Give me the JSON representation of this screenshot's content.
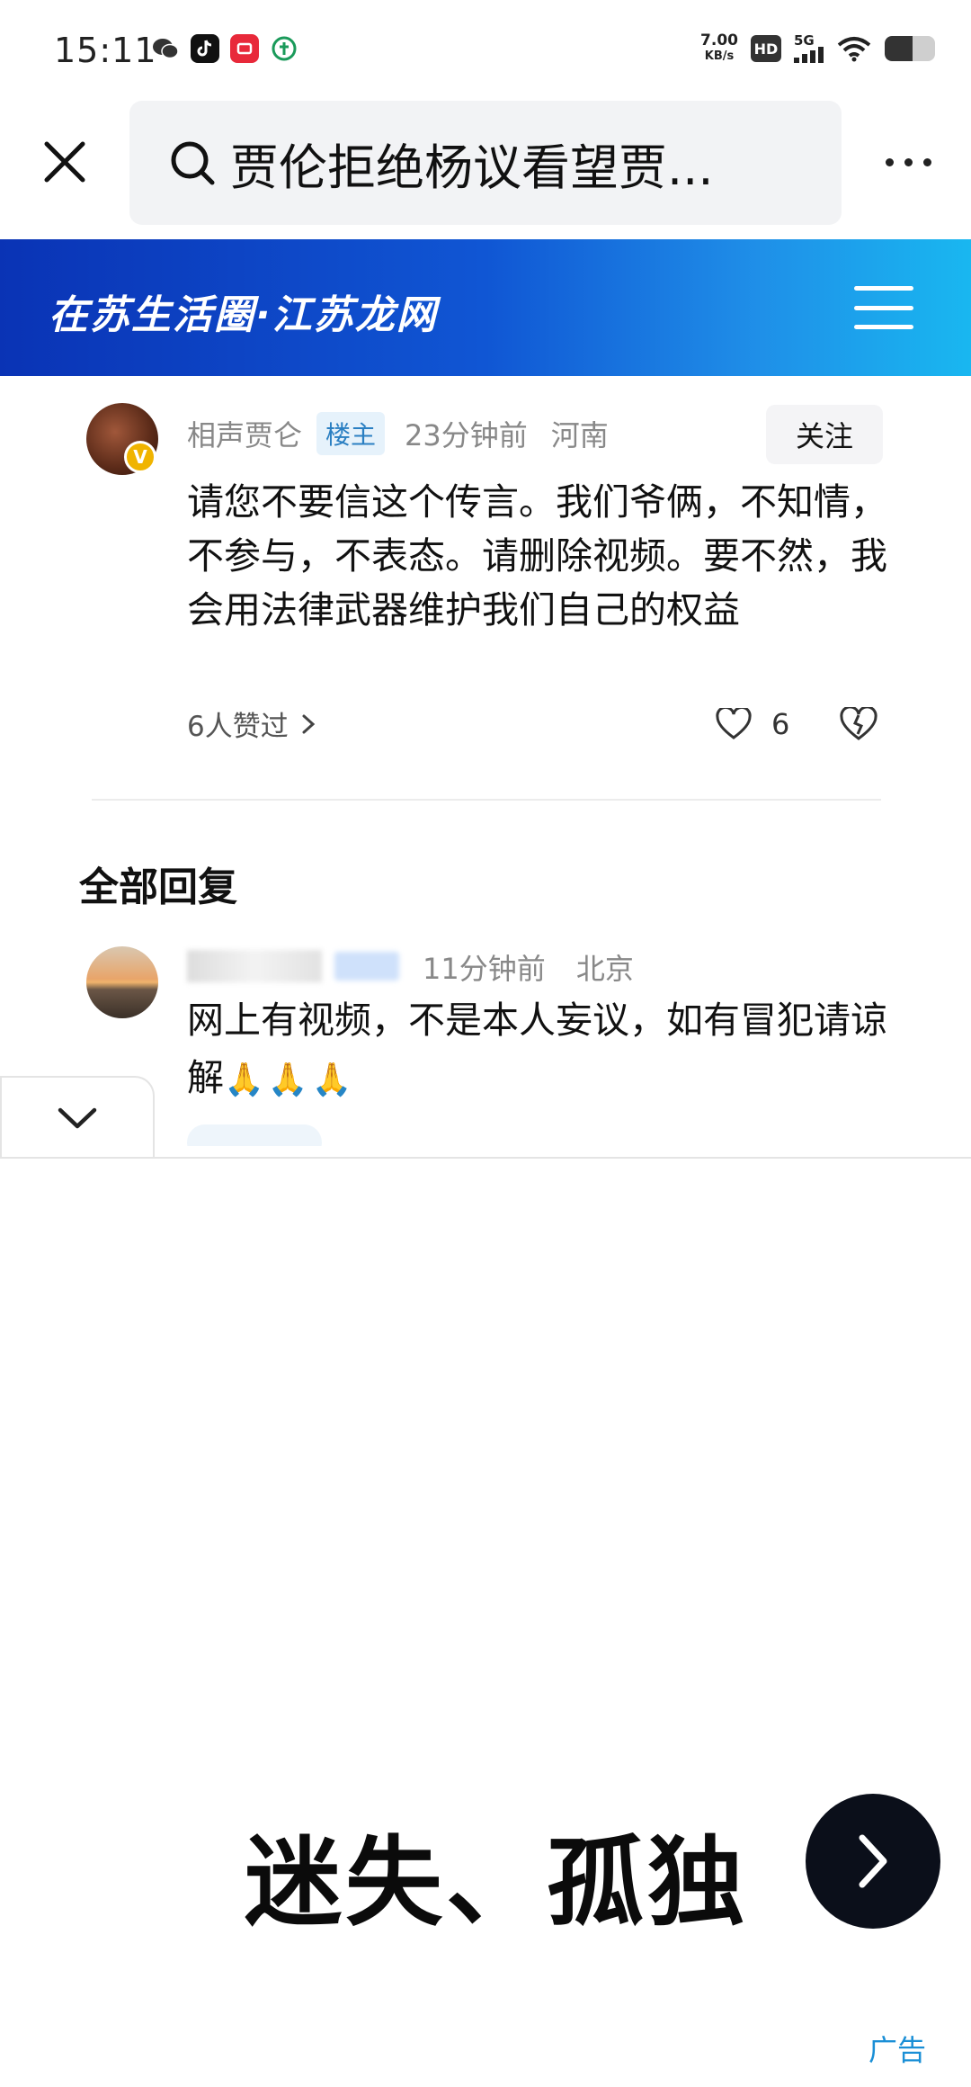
{
  "status_bar": {
    "time": "15:11",
    "net_speed_value": "7.00",
    "net_speed_unit": "KB/s",
    "hd": "HD",
    "network": "5G",
    "battery_level": 0.55
  },
  "header": {
    "search_query": "贾伦拒绝杨议看望贾..."
  },
  "banner": {
    "title": "在苏生活圈·江苏龙网"
  },
  "main_comment": {
    "author": "相声贾仑",
    "op_badge": "楼主",
    "time": "23分钟前",
    "location": "河南",
    "follow_label": "关注",
    "text": "请您不要信这个传言。我们爷俩，不知情，不参与，不表态。请删除视频。要不然，我会用法律武器维护我们自己的权益",
    "likes_summary": "6人赞过",
    "like_count": "6"
  },
  "replies_section": {
    "title": "全部回复"
  },
  "reply": {
    "time": "11分钟前",
    "location": "北京",
    "text": "网上有视频，不是本人妄议，如有冒犯请谅解",
    "emoji": "🙏🙏🙏"
  },
  "ad": {
    "headline": "迷失、孤独",
    "label": "广告"
  }
}
